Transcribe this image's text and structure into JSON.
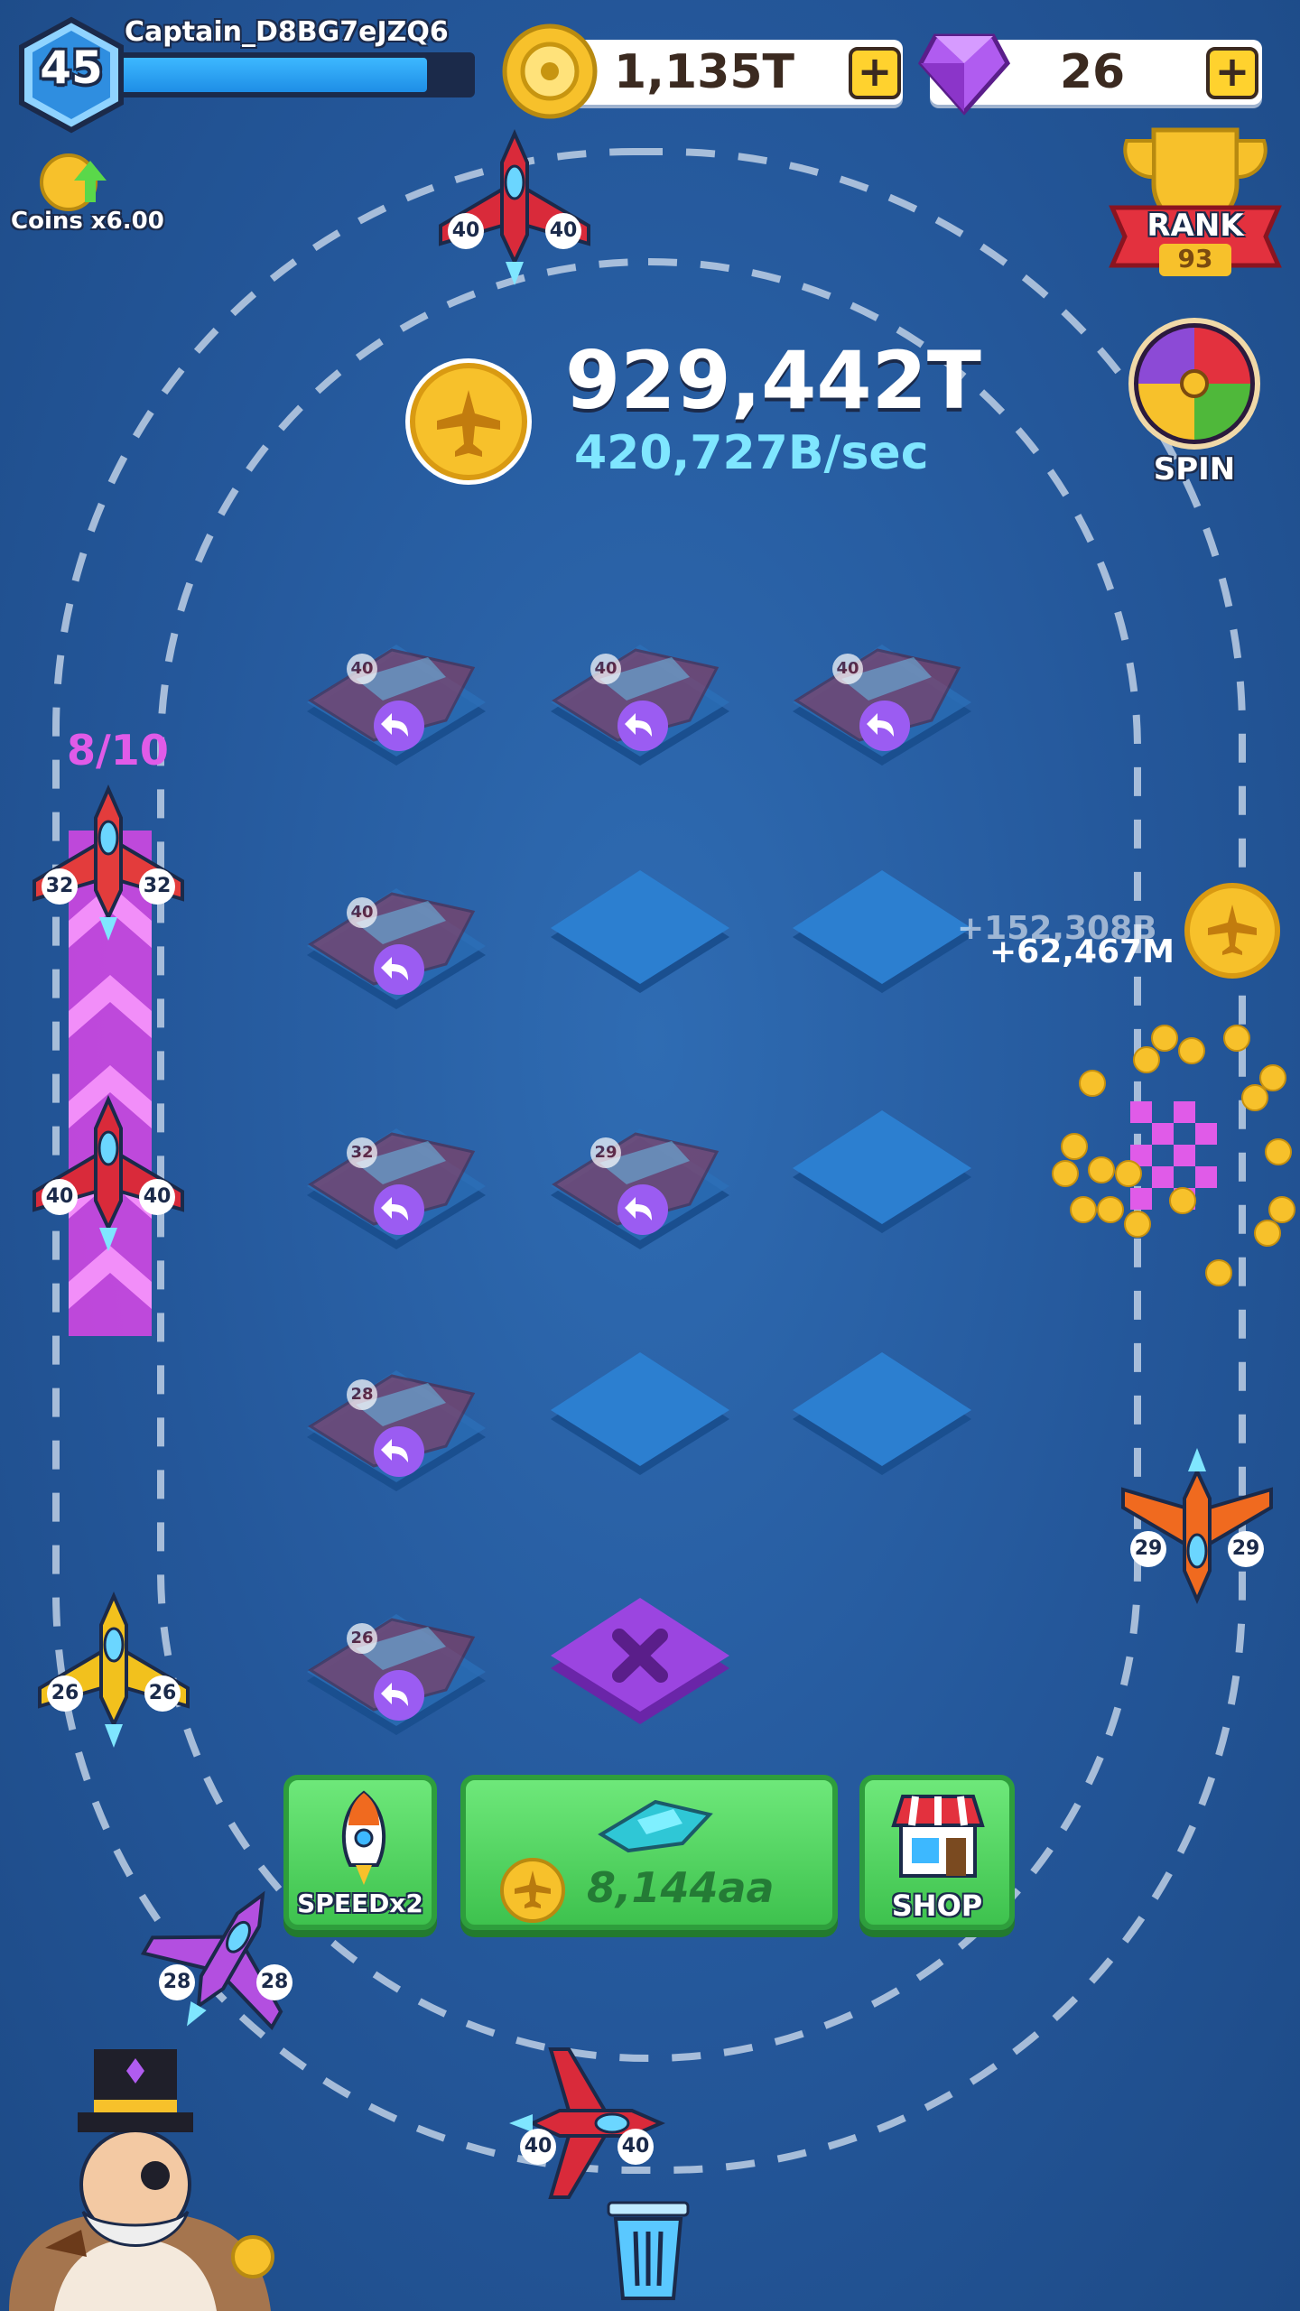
{
  "player": {
    "level": "45",
    "name": "Captain_D8BG7eJZQ6",
    "xp_progress": 0.88
  },
  "resources": {
    "coins": "1,135T",
    "gems": "26",
    "plus_label": "+"
  },
  "multiplier": {
    "label": "Coins x6.00"
  },
  "rank": {
    "label": "RANK",
    "value": "93"
  },
  "spin": {
    "label": "SPIN"
  },
  "earnings": {
    "total": "929,442T",
    "rate": "420,727B/sec"
  },
  "slots": {
    "capacity": "8/10"
  },
  "floating_rewards": [
    "+152,308B",
    "+62,467M"
  ],
  "merge_grid": [
    {
      "row": 0,
      "col": 0,
      "state": "plane",
      "level": "40"
    },
    {
      "row": 0,
      "col": 1,
      "state": "plane",
      "level": "40"
    },
    {
      "row": 0,
      "col": 2,
      "state": "plane",
      "level": "40"
    },
    {
      "row": 1,
      "col": 0,
      "state": "plane",
      "level": "40"
    },
    {
      "row": 1,
      "col": 1,
      "state": "empty"
    },
    {
      "row": 1,
      "col": 2,
      "state": "empty"
    },
    {
      "row": 2,
      "col": 0,
      "state": "plane",
      "level": "32"
    },
    {
      "row": 2,
      "col": 1,
      "state": "plane",
      "level": "29"
    },
    {
      "row": 2,
      "col": 2,
      "state": "empty"
    },
    {
      "row": 3,
      "col": 0,
      "state": "plane",
      "level": "28"
    },
    {
      "row": 3,
      "col": 1,
      "state": "empty"
    },
    {
      "row": 3,
      "col": 2,
      "state": "empty"
    },
    {
      "row": 4,
      "col": 0,
      "state": "plane",
      "level": "26"
    },
    {
      "row": 4,
      "col": 1,
      "state": "delete"
    }
  ],
  "track_planes": [
    {
      "id": "top",
      "level": "40",
      "color": "#d92a3a"
    },
    {
      "id": "left-upper",
      "level": "32",
      "color": "#e33c3c"
    },
    {
      "id": "left-mid",
      "level": "40",
      "color": "#d92a3a"
    },
    {
      "id": "left-gold",
      "level": "26",
      "color": "#f2c11d"
    },
    {
      "id": "left-purple",
      "level": "28",
      "color": "#b34fe0"
    },
    {
      "id": "bottom",
      "level": "40",
      "color": "#d92a3a"
    },
    {
      "id": "right-orange",
      "level": "29",
      "color": "#f06a1f"
    }
  ],
  "actions": {
    "speed_label": "SPEEDx2",
    "buy_price": "8,144aa",
    "shop_label": "SHOP"
  },
  "colors": {
    "background": "#24579a",
    "coin": "#f7c12b",
    "gem": "#b05cf0",
    "button_green": "#4fd05e",
    "delete_purple": "#9b45e0",
    "capacity_text": "#e05be8"
  }
}
